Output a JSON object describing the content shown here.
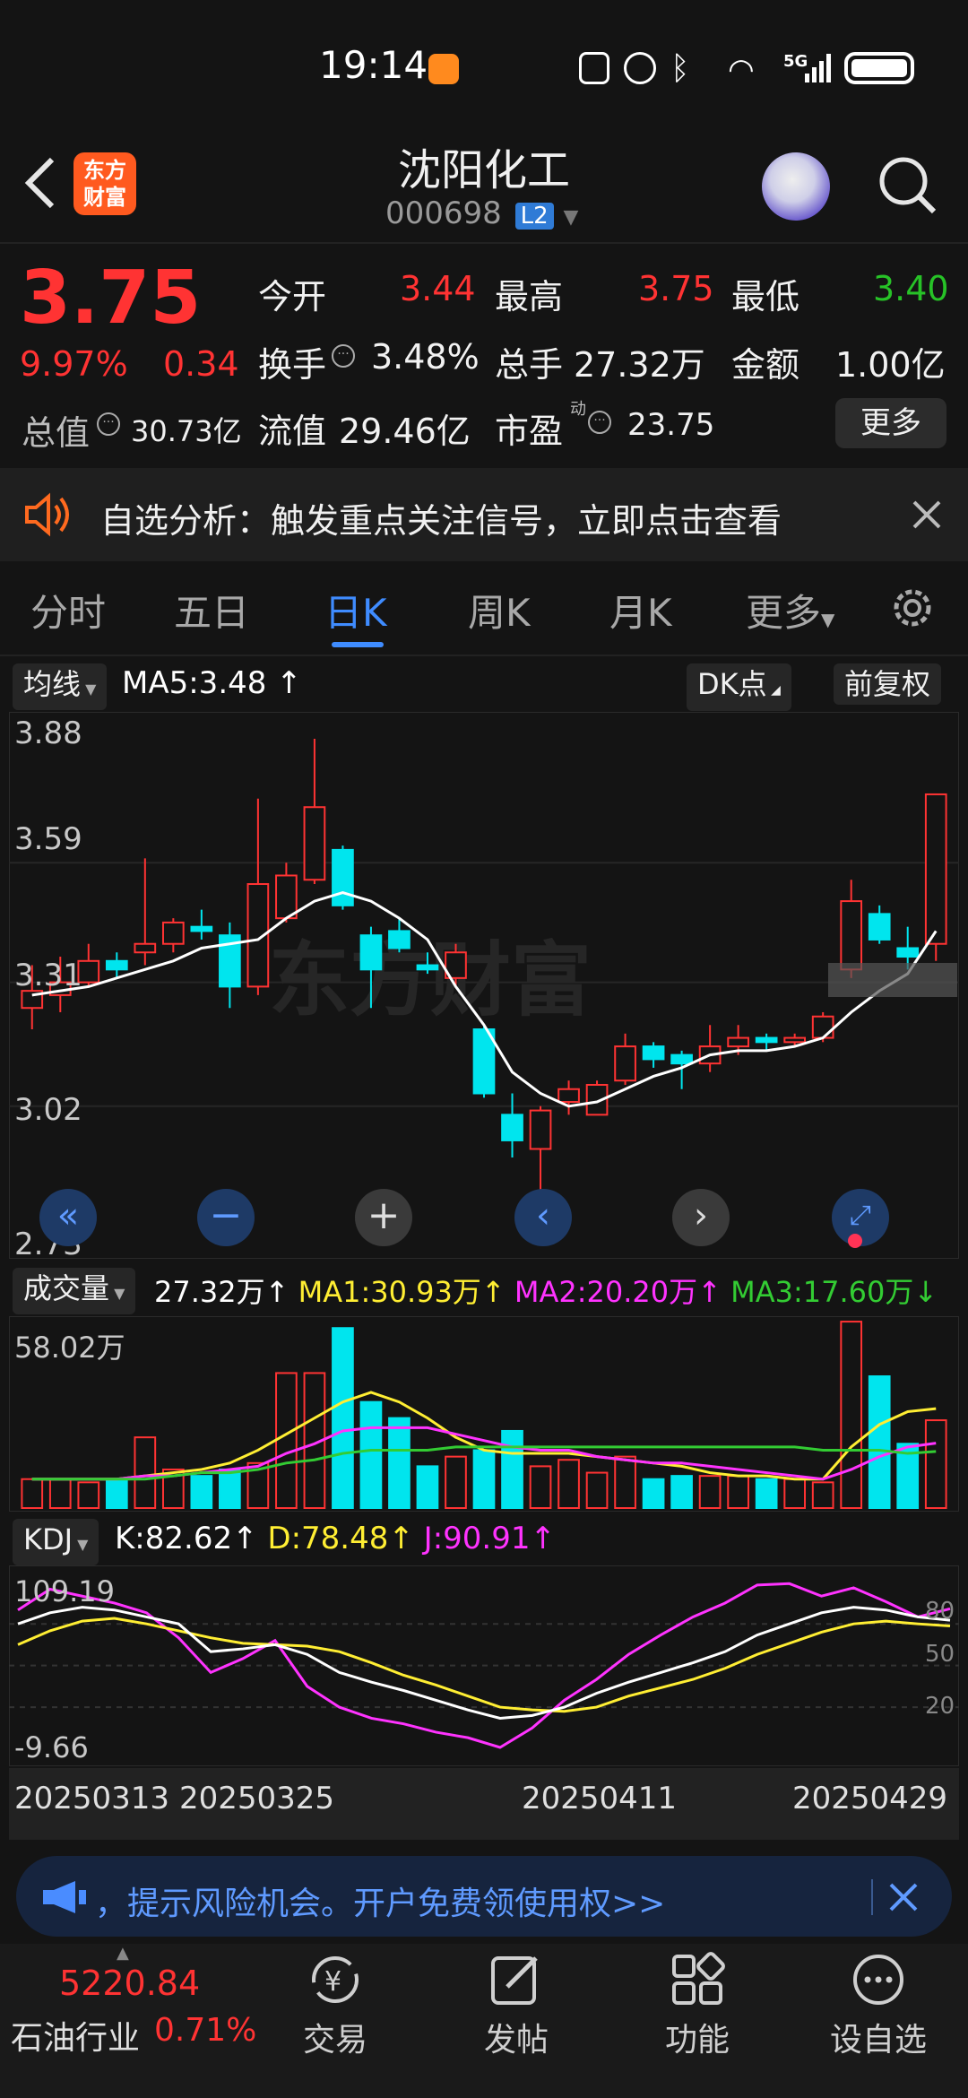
{
  "status_bar": {
    "time": "19:14",
    "network": "5G"
  },
  "header": {
    "logo_line1": "东方",
    "logo_line2": "财富",
    "title": "沈阳化工",
    "code": "000698",
    "level_badge": "L2"
  },
  "quote": {
    "price": "3.75",
    "change_pct": "9.97%",
    "change": "0.34",
    "open_label": "今开",
    "open": "3.44",
    "high_label": "最高",
    "high": "3.75",
    "low_label": "最低",
    "low": "3.40",
    "turnover_label": "换手",
    "turnover": "3.48%",
    "volume_label": "总手",
    "volume": "27.32万",
    "amount_label": "金额",
    "amount": "1.00亿",
    "mktcap_label": "总值",
    "mktcap": "30.73亿",
    "float_label": "流值",
    "float": "29.46亿",
    "pe_label": "市盈",
    "pe_sup": "动",
    "pe": "23.75",
    "more": "更多"
  },
  "notice": {
    "text": "自选分析：触发重点关注信号，立即点击查看"
  },
  "tabs": [
    "分时",
    "五日",
    "日K",
    "周K",
    "月K",
    "更多"
  ],
  "active_tab": "日K",
  "kline": {
    "indicator_select": "均线",
    "ma5": "MA5:3.48",
    "dk_button": "DK点",
    "fq_button": "前复权",
    "y_ticks": [
      "3.88",
      "3.59",
      "3.31",
      "3.02",
      "2.73"
    ],
    "watermark": "东方财富"
  },
  "volume": {
    "select": "成交量",
    "value": "27.32万",
    "ma1": "MA1:30.93万",
    "ma2": "MA2:20.20万",
    "ma3": "MA3:17.60万",
    "y_max": "58.02万"
  },
  "kdj": {
    "select": "KDJ",
    "k": "K:82.62",
    "d": "D:78.48",
    "j": "J:90.91",
    "y_max": "109.19",
    "y_min": "-9.66",
    "levels": [
      "80",
      "50",
      "20"
    ]
  },
  "x_dates": [
    "20250313",
    "20250325",
    "20250411",
    "20250429"
  ],
  "banner": {
    "text": "，提示风险机会。开户免费领使用权>>"
  },
  "bottom_bar": {
    "index_value": "5220.84",
    "index_name": "石油行业",
    "index_change": "0.71%",
    "items": [
      "交易",
      "发帖",
      "功能",
      "设自选"
    ]
  },
  "colors": {
    "up": "#ff3333",
    "down": "#00e5ee",
    "ma5": "#ffffff",
    "ma1": "#ffee33",
    "ma2": "#ff33ff",
    "ma3": "#33cc33"
  },
  "chart_data": {
    "type": "candlestick",
    "title": "",
    "ylim": [
      2.73,
      3.88
    ],
    "candles": [
      {
        "o": 3.25,
        "c": 3.29,
        "h": 3.35,
        "l": 3.2
      },
      {
        "o": 3.28,
        "c": 3.31,
        "h": 3.37,
        "l": 3.24
      },
      {
        "o": 3.31,
        "c": 3.36,
        "h": 3.4,
        "l": 3.3
      },
      {
        "o": 3.36,
        "c": 3.34,
        "h": 3.38,
        "l": 3.32
      },
      {
        "o": 3.38,
        "c": 3.4,
        "h": 3.6,
        "l": 3.35
      },
      {
        "o": 3.4,
        "c": 3.45,
        "h": 3.46,
        "l": 3.38
      },
      {
        "o": 3.44,
        "c": 3.43,
        "h": 3.48,
        "l": 3.41
      },
      {
        "o": 3.42,
        "c": 3.3,
        "h": 3.45,
        "l": 3.25
      },
      {
        "o": 3.3,
        "c": 3.54,
        "h": 3.74,
        "l": 3.28
      },
      {
        "o": 3.46,
        "c": 3.56,
        "h": 3.59,
        "l": 3.45
      },
      {
        "o": 3.55,
        "c": 3.72,
        "h": 3.88,
        "l": 3.54
      },
      {
        "o": 3.62,
        "c": 3.49,
        "h": 3.63,
        "l": 3.48
      },
      {
        "o": 3.42,
        "c": 3.34,
        "h": 3.44,
        "l": 3.25
      },
      {
        "o": 3.43,
        "c": 3.39,
        "h": 3.46,
        "l": 3.38
      },
      {
        "o": 3.35,
        "c": 3.34,
        "h": 3.38,
        "l": 3.33
      },
      {
        "o": 3.32,
        "c": 3.38,
        "h": 3.4,
        "l": 3.3
      },
      {
        "o": 3.2,
        "c": 3.05,
        "h": 3.21,
        "l": 3.04
      },
      {
        "o": 3.0,
        "c": 2.94,
        "h": 3.05,
        "l": 2.9
      },
      {
        "o": 2.92,
        "c": 3.01,
        "h": 3.02,
        "l": 2.73
      },
      {
        "o": 3.03,
        "c": 3.06,
        "h": 3.08,
        "l": 3.0
      },
      {
        "o": 3.0,
        "c": 3.07,
        "h": 3.08,
        "l": 3.0
      },
      {
        "o": 3.08,
        "c": 3.16,
        "h": 3.19,
        "l": 3.07
      },
      {
        "o": 3.16,
        "c": 3.13,
        "h": 3.17,
        "l": 3.11
      },
      {
        "o": 3.14,
        "c": 3.12,
        "h": 3.15,
        "l": 3.06
      },
      {
        "o": 3.12,
        "c": 3.16,
        "h": 3.21,
        "l": 3.1
      },
      {
        "o": 3.16,
        "c": 3.18,
        "h": 3.21,
        "l": 3.14
      },
      {
        "o": 3.18,
        "c": 3.17,
        "h": 3.19,
        "l": 3.15
      },
      {
        "o": 3.17,
        "c": 3.18,
        "h": 3.19,
        "l": 3.16
      },
      {
        "o": 3.18,
        "c": 3.23,
        "h": 3.24,
        "l": 3.17
      },
      {
        "o": 3.34,
        "c": 3.5,
        "h": 3.55,
        "l": 3.32
      },
      {
        "o": 3.47,
        "c": 3.41,
        "h": 3.49,
        "l": 3.4
      },
      {
        "o": 3.39,
        "c": 3.37,
        "h": 3.44,
        "l": 3.34
      },
      {
        "o": 3.4,
        "c": 3.75,
        "h": 3.75,
        "l": 3.36
      }
    ],
    "ma5": [
      3.28,
      3.29,
      3.3,
      3.32,
      3.34,
      3.36,
      3.39,
      3.4,
      3.41,
      3.46,
      3.5,
      3.52,
      3.5,
      3.46,
      3.41,
      3.3,
      3.21,
      3.1,
      3.05,
      3.02,
      3.03,
      3.06,
      3.09,
      3.11,
      3.14,
      3.15,
      3.15,
      3.16,
      3.18,
      3.24,
      3.29,
      3.33,
      3.43
    ],
    "volume_ylim": [
      0,
      58.02
    ],
    "volume": [
      9,
      9,
      8,
      9,
      22,
      12,
      10,
      12,
      14,
      42,
      42,
      56,
      33,
      28,
      13,
      16,
      18,
      24,
      13,
      15,
      11,
      16,
      9,
      10,
      10,
      10,
      9,
      9,
      8,
      58,
      41,
      20,
      27.32
    ],
    "ma1": [
      9,
      9,
      9,
      9,
      10,
      11,
      12,
      14,
      18,
      23,
      28,
      33,
      36,
      33,
      28,
      22,
      18,
      17,
      17,
      17,
      16,
      15,
      14,
      13,
      11,
      10,
      10,
      9,
      9,
      19,
      26,
      30,
      30.93
    ],
    "ma2": [
      9,
      9,
      9,
      9,
      10,
      10,
      11,
      12,
      13,
      17,
      20,
      24,
      25,
      25,
      25,
      23,
      21,
      19,
      18,
      18,
      16,
      15,
      14,
      14,
      13,
      12,
      11,
      10,
      9,
      12,
      16,
      19,
      20.2
    ],
    "ma3": [
      9,
      9,
      9,
      9,
      9,
      10,
      11,
      11,
      12,
      14,
      15,
      17,
      18,
      18,
      18,
      19,
      19,
      19,
      19,
      19,
      19,
      19,
      19,
      19,
      19,
      19,
      19,
      19,
      18,
      18,
      18,
      17,
      17.6
    ],
    "kdj_ylim": [
      -9.66,
      109.19
    ],
    "K": [
      80,
      88,
      92,
      90,
      85,
      80,
      60,
      62,
      65,
      58,
      45,
      38,
      32,
      25,
      18,
      12,
      14,
      20,
      30,
      38,
      45,
      52,
      60,
      72,
      80,
      88,
      92,
      90,
      85,
      82.62
    ],
    "D": [
      65,
      75,
      82,
      84,
      80,
      75,
      70,
      66,
      65,
      64,
      60,
      52,
      43,
      36,
      28,
      20,
      18,
      17,
      20,
      28,
      34,
      40,
      48,
      58,
      66,
      74,
      80,
      82,
      80,
      78.48
    ],
    "J": [
      90,
      105,
      100,
      95,
      88,
      70,
      45,
      55,
      68,
      35,
      20,
      12,
      8,
      2,
      -2,
      -9,
      5,
      25,
      40,
      58,
      72,
      85,
      95,
      108,
      109,
      100,
      106,
      96,
      85,
      90.91
    ]
  }
}
